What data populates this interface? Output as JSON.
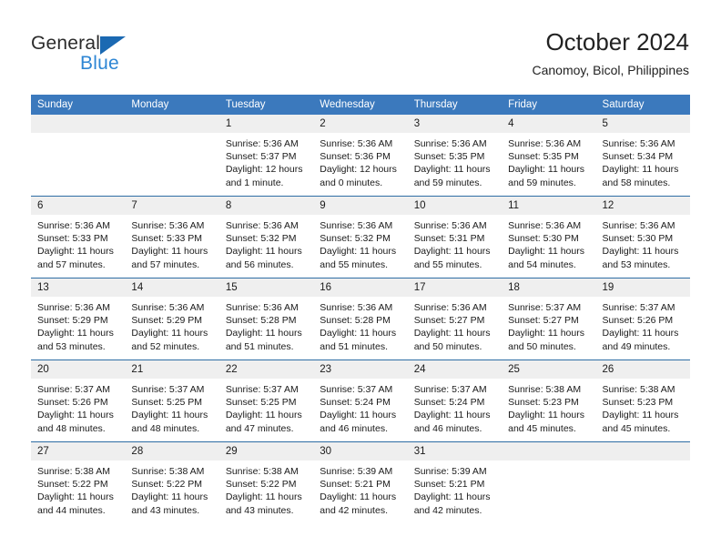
{
  "brand": {
    "name_top": "General",
    "name_bottom": "Blue",
    "triangle_color": "#1b69b2",
    "blue_text_color": "#2e86d4"
  },
  "header": {
    "title": "October 2024",
    "subtitle": "Canomoy, Bicol, Philippines",
    "header_bg_color": "#3b79bd",
    "date_strip_color": "#efefef"
  },
  "calendar": {
    "weekday_headers": [
      "Sunday",
      "Monday",
      "Tuesday",
      "Wednesday",
      "Thursday",
      "Friday",
      "Saturday"
    ],
    "labels": {
      "sunrise": "Sunrise:",
      "sunset": "Sunset:",
      "daylight": "Daylight:"
    },
    "weeks": [
      [
        {
          "day": "",
          "sunrise": "",
          "sunset": "",
          "daylight_line1": "",
          "daylight_line2": "",
          "empty": true
        },
        {
          "day": "",
          "sunrise": "",
          "sunset": "",
          "daylight_line1": "",
          "daylight_line2": "",
          "empty": true
        },
        {
          "day": "1",
          "sunrise": "Sunrise: 5:36 AM",
          "sunset": "Sunset: 5:37 PM",
          "daylight_line1": "Daylight: 12 hours",
          "daylight_line2": "and 1 minute.",
          "empty": false
        },
        {
          "day": "2",
          "sunrise": "Sunrise: 5:36 AM",
          "sunset": "Sunset: 5:36 PM",
          "daylight_line1": "Daylight: 12 hours",
          "daylight_line2": "and 0 minutes.",
          "empty": false
        },
        {
          "day": "3",
          "sunrise": "Sunrise: 5:36 AM",
          "sunset": "Sunset: 5:35 PM",
          "daylight_line1": "Daylight: 11 hours",
          "daylight_line2": "and 59 minutes.",
          "empty": false
        },
        {
          "day": "4",
          "sunrise": "Sunrise: 5:36 AM",
          "sunset": "Sunset: 5:35 PM",
          "daylight_line1": "Daylight: 11 hours",
          "daylight_line2": "and 59 minutes.",
          "empty": false
        },
        {
          "day": "5",
          "sunrise": "Sunrise: 5:36 AM",
          "sunset": "Sunset: 5:34 PM",
          "daylight_line1": "Daylight: 11 hours",
          "daylight_line2": "and 58 minutes.",
          "empty": false
        }
      ],
      [
        {
          "day": "6",
          "sunrise": "Sunrise: 5:36 AM",
          "sunset": "Sunset: 5:33 PM",
          "daylight_line1": "Daylight: 11 hours",
          "daylight_line2": "and 57 minutes.",
          "empty": false
        },
        {
          "day": "7",
          "sunrise": "Sunrise: 5:36 AM",
          "sunset": "Sunset: 5:33 PM",
          "daylight_line1": "Daylight: 11 hours",
          "daylight_line2": "and 57 minutes.",
          "empty": false
        },
        {
          "day": "8",
          "sunrise": "Sunrise: 5:36 AM",
          "sunset": "Sunset: 5:32 PM",
          "daylight_line1": "Daylight: 11 hours",
          "daylight_line2": "and 56 minutes.",
          "empty": false
        },
        {
          "day": "9",
          "sunrise": "Sunrise: 5:36 AM",
          "sunset": "Sunset: 5:32 PM",
          "daylight_line1": "Daylight: 11 hours",
          "daylight_line2": "and 55 minutes.",
          "empty": false
        },
        {
          "day": "10",
          "sunrise": "Sunrise: 5:36 AM",
          "sunset": "Sunset: 5:31 PM",
          "daylight_line1": "Daylight: 11 hours",
          "daylight_line2": "and 55 minutes.",
          "empty": false
        },
        {
          "day": "11",
          "sunrise": "Sunrise: 5:36 AM",
          "sunset": "Sunset: 5:30 PM",
          "daylight_line1": "Daylight: 11 hours",
          "daylight_line2": "and 54 minutes.",
          "empty": false
        },
        {
          "day": "12",
          "sunrise": "Sunrise: 5:36 AM",
          "sunset": "Sunset: 5:30 PM",
          "daylight_line1": "Daylight: 11 hours",
          "daylight_line2": "and 53 minutes.",
          "empty": false
        }
      ],
      [
        {
          "day": "13",
          "sunrise": "Sunrise: 5:36 AM",
          "sunset": "Sunset: 5:29 PM",
          "daylight_line1": "Daylight: 11 hours",
          "daylight_line2": "and 53 minutes.",
          "empty": false
        },
        {
          "day": "14",
          "sunrise": "Sunrise: 5:36 AM",
          "sunset": "Sunset: 5:29 PM",
          "daylight_line1": "Daylight: 11 hours",
          "daylight_line2": "and 52 minutes.",
          "empty": false
        },
        {
          "day": "15",
          "sunrise": "Sunrise: 5:36 AM",
          "sunset": "Sunset: 5:28 PM",
          "daylight_line1": "Daylight: 11 hours",
          "daylight_line2": "and 51 minutes.",
          "empty": false
        },
        {
          "day": "16",
          "sunrise": "Sunrise: 5:36 AM",
          "sunset": "Sunset: 5:28 PM",
          "daylight_line1": "Daylight: 11 hours",
          "daylight_line2": "and 51 minutes.",
          "empty": false
        },
        {
          "day": "17",
          "sunrise": "Sunrise: 5:36 AM",
          "sunset": "Sunset: 5:27 PM",
          "daylight_line1": "Daylight: 11 hours",
          "daylight_line2": "and 50 minutes.",
          "empty": false
        },
        {
          "day": "18",
          "sunrise": "Sunrise: 5:37 AM",
          "sunset": "Sunset: 5:27 PM",
          "daylight_line1": "Daylight: 11 hours",
          "daylight_line2": "and 50 minutes.",
          "empty": false
        },
        {
          "day": "19",
          "sunrise": "Sunrise: 5:37 AM",
          "sunset": "Sunset: 5:26 PM",
          "daylight_line1": "Daylight: 11 hours",
          "daylight_line2": "and 49 minutes.",
          "empty": false
        }
      ],
      [
        {
          "day": "20",
          "sunrise": "Sunrise: 5:37 AM",
          "sunset": "Sunset: 5:26 PM",
          "daylight_line1": "Daylight: 11 hours",
          "daylight_line2": "and 48 minutes.",
          "empty": false
        },
        {
          "day": "21",
          "sunrise": "Sunrise: 5:37 AM",
          "sunset": "Sunset: 5:25 PM",
          "daylight_line1": "Daylight: 11 hours",
          "daylight_line2": "and 48 minutes.",
          "empty": false
        },
        {
          "day": "22",
          "sunrise": "Sunrise: 5:37 AM",
          "sunset": "Sunset: 5:25 PM",
          "daylight_line1": "Daylight: 11 hours",
          "daylight_line2": "and 47 minutes.",
          "empty": false
        },
        {
          "day": "23",
          "sunrise": "Sunrise: 5:37 AM",
          "sunset": "Sunset: 5:24 PM",
          "daylight_line1": "Daylight: 11 hours",
          "daylight_line2": "and 46 minutes.",
          "empty": false
        },
        {
          "day": "24",
          "sunrise": "Sunrise: 5:37 AM",
          "sunset": "Sunset: 5:24 PM",
          "daylight_line1": "Daylight: 11 hours",
          "daylight_line2": "and 46 minutes.",
          "empty": false
        },
        {
          "day": "25",
          "sunrise": "Sunrise: 5:38 AM",
          "sunset": "Sunset: 5:23 PM",
          "daylight_line1": "Daylight: 11 hours",
          "daylight_line2": "and 45 minutes.",
          "empty": false
        },
        {
          "day": "26",
          "sunrise": "Sunrise: 5:38 AM",
          "sunset": "Sunset: 5:23 PM",
          "daylight_line1": "Daylight: 11 hours",
          "daylight_line2": "and 45 minutes.",
          "empty": false
        }
      ],
      [
        {
          "day": "27",
          "sunrise": "Sunrise: 5:38 AM",
          "sunset": "Sunset: 5:22 PM",
          "daylight_line1": "Daylight: 11 hours",
          "daylight_line2": "and 44 minutes.",
          "empty": false
        },
        {
          "day": "28",
          "sunrise": "Sunrise: 5:38 AM",
          "sunset": "Sunset: 5:22 PM",
          "daylight_line1": "Daylight: 11 hours",
          "daylight_line2": "and 43 minutes.",
          "empty": false
        },
        {
          "day": "29",
          "sunrise": "Sunrise: 5:38 AM",
          "sunset": "Sunset: 5:22 PM",
          "daylight_line1": "Daylight: 11 hours",
          "daylight_line2": "and 43 minutes.",
          "empty": false
        },
        {
          "day": "30",
          "sunrise": "Sunrise: 5:39 AM",
          "sunset": "Sunset: 5:21 PM",
          "daylight_line1": "Daylight: 11 hours",
          "daylight_line2": "and 42 minutes.",
          "empty": false
        },
        {
          "day": "31",
          "sunrise": "Sunrise: 5:39 AM",
          "sunset": "Sunset: 5:21 PM",
          "daylight_line1": "Daylight: 11 hours",
          "daylight_line2": "and 42 minutes.",
          "empty": false
        },
        {
          "day": "",
          "sunrise": "",
          "sunset": "",
          "daylight_line1": "",
          "daylight_line2": "",
          "empty": true
        },
        {
          "day": "",
          "sunrise": "",
          "sunset": "",
          "daylight_line1": "",
          "daylight_line2": "",
          "empty": true
        }
      ]
    ]
  }
}
